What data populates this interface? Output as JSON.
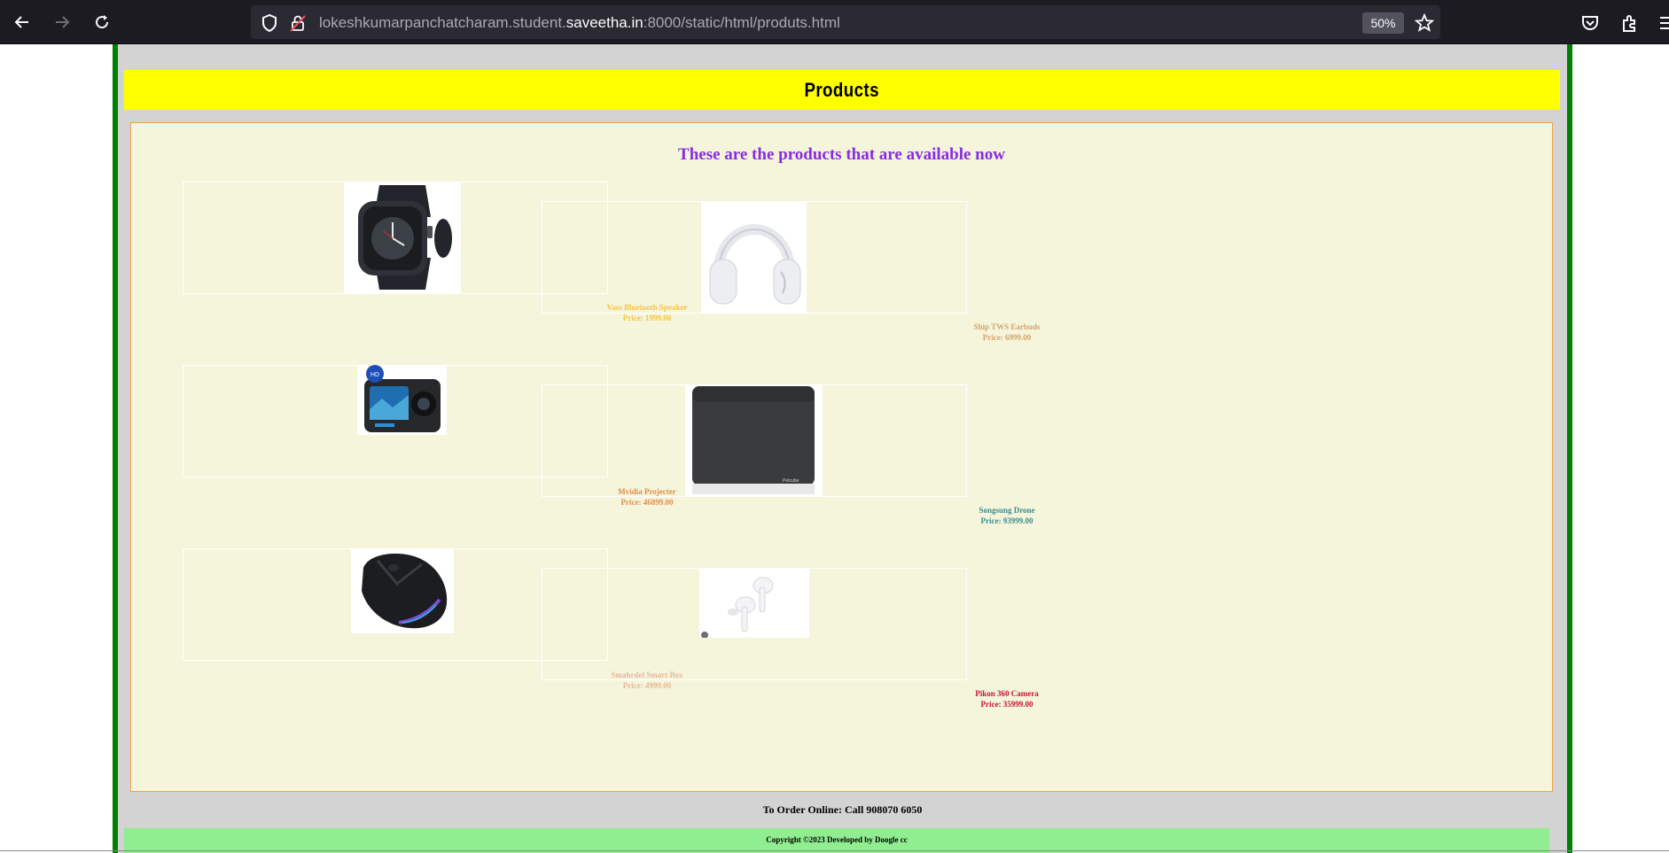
{
  "browser": {
    "url_prefix": "lokeshkumarpanchatcharam.student.",
    "url_domain": "saveetha.in",
    "url_suffix": ":8000/static/html/produts.html",
    "zoom": "50%"
  },
  "page": {
    "title": "Products",
    "intro": "These are the products that are available now",
    "products": [
      {
        "name": "Vass Bluetooth Speaker",
        "price": "Price: 1999.00",
        "color": "#f5c542",
        "image": "smartwatch"
      },
      {
        "name": "Ship TWS Earbuds",
        "price": "Price: 6999.00",
        "color": "#d2a56d",
        "image": "headphones"
      },
      {
        "name": "Mvidia Projecter",
        "price": "Price: 46899.00",
        "color": "#e0904a",
        "image": "action-camera"
      },
      {
        "name": "Songsung Drone",
        "price": "Price: 93999.00",
        "color": "#3c8c8c",
        "image": "smart-speaker"
      },
      {
        "name": "Smahrdel Smart Box",
        "price": "Price: 4999.00",
        "color": "#e6b89a",
        "image": "gaming-mouse"
      },
      {
        "name": "Pikon 360 Camera",
        "price": "Price: 35999.00",
        "color": "#cc1133",
        "image": "earbuds"
      }
    ],
    "order_text": "To Order Online: Call 908070 6050",
    "footer_text": "Copyright ©2023 Developed by Doogle cc"
  }
}
